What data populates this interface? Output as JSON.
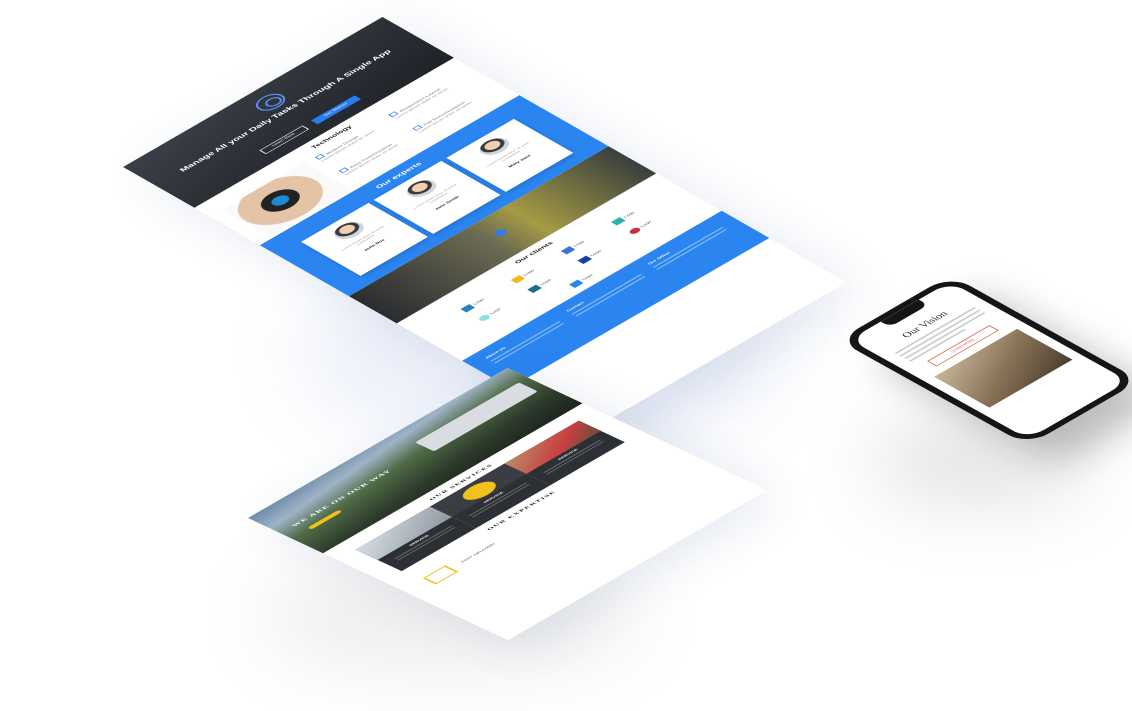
{
  "main_page": {
    "hero": {
      "title": "Manage All your Daily Tasks Through A Single App",
      "buttons": [
        "Learn More",
        "Get Started"
      ]
    },
    "technology": {
      "heading": "Technology",
      "features": [
        {
          "title": "Modern Design",
          "text": "Lorem ipsum dolor sit amet"
        },
        {
          "title": "Responsive Layout",
          "text": "Lorem ipsum dolor sit amet"
        },
        {
          "title": "Easy Customization",
          "text": "Lorem ipsum dolor sit amet"
        },
        {
          "title": "Full Documentation",
          "text": "Lorem ipsum dolor sit amet"
        }
      ]
    },
    "experts": {
      "heading": "Our experts",
      "cards": [
        {
          "name": "John Doe",
          "text": "Lorem ipsum dolor sit amet consectetur"
        },
        {
          "name": "Jane Smith",
          "text": "Lorem ipsum dolor sit amet consectetur"
        },
        {
          "name": "Mary Jane",
          "text": "Lorem ipsum dolor sit amet consectetur"
        }
      ]
    },
    "clients": {
      "heading": "Our clients",
      "logos": [
        "Logo",
        "Logo",
        "Logo",
        "Logo",
        "Logo",
        "Logo",
        "Logo",
        "Logo",
        "Logo"
      ]
    },
    "footer": {
      "columns": [
        "About Us",
        "Contact",
        "Our Office"
      ]
    }
  },
  "secondary_page": {
    "hero_title": "WE ARE ON OUR WAY",
    "services_heading": "OUR SERVICES",
    "services": [
      "SERVICE",
      "SERVICE",
      "SERVICE"
    ],
    "expertise_heading": "OUR EXPERTISE",
    "expertise_item": "FAST DELIVERY"
  },
  "phone": {
    "title": "Our Vision",
    "button": "LEARN MORE"
  },
  "colors": {
    "accent": "#2a85f1",
    "yellow": "#f0c21b",
    "dark": "#2c2f34"
  }
}
